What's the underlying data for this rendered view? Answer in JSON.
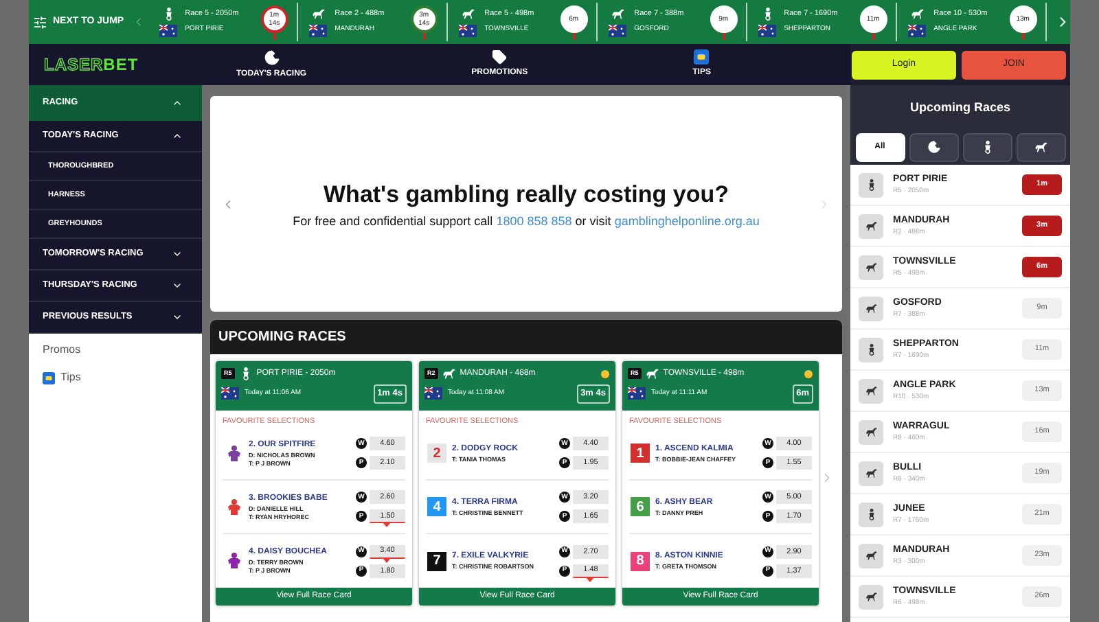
{
  "next_to_jump": {
    "label": "NEXT TO JUMP",
    "races": [
      {
        "kind": "harness",
        "race": "Race 5 - 2050m",
        "venue": "PORT PIRIE",
        "timer": "1m 14s",
        "color": "#c62828"
      },
      {
        "kind": "greyhound",
        "race": "Race 2 - 488m",
        "venue": "MANDURAH",
        "timer": "3m 14s",
        "color": "#2e7d32"
      },
      {
        "kind": "greyhound",
        "race": "Race 5 - 498m",
        "venue": "TOWNSVILLE",
        "timer": "6m",
        "color": "#ffffff"
      },
      {
        "kind": "greyhound",
        "race": "Race 7 - 388m",
        "venue": "GOSFORD",
        "timer": "9m",
        "color": "#ffffff"
      },
      {
        "kind": "harness",
        "race": "Race 7 - 1690m",
        "venue": "SHEPPARTON",
        "timer": "11m",
        "color": "#ffffff"
      },
      {
        "kind": "greyhound",
        "race": "Race 10 - 530m",
        "venue": "ANGLE PARK",
        "timer": "13m",
        "color": "#ffffff"
      }
    ]
  },
  "header": {
    "logo_first": "LASER",
    "logo_second": "BET",
    "nav": [
      {
        "kind": "racing",
        "label": "TODAY'S RACING"
      },
      {
        "kind": "promotions",
        "label": "PROMOTIONS"
      },
      {
        "kind": "tips",
        "label": "TIPS"
      }
    ],
    "login": "Login",
    "join": "JOIN"
  },
  "sidebar": {
    "items": [
      {
        "label": "RACING",
        "selected": true,
        "expanded": true,
        "children": [
          {
            "label": "TODAY'S RACING",
            "selected": false,
            "expanded": true,
            "children": [
              {
                "label": "THOROUGHBRED",
                "selected": false
              },
              {
                "label": "HARNESS",
                "selected": false
              },
              {
                "label": "GREYHOUNDS",
                "selected": false
              }
            ]
          },
          {
            "label": "TOMORROW'S RACING",
            "selected": false,
            "expanded": false
          },
          {
            "label": "THURSDAY'S RACING",
            "selected": false,
            "expanded": false
          },
          {
            "label": "PREVIOUS RESULTS",
            "selected": false,
            "expanded": false
          }
        ]
      }
    ],
    "links": [
      {
        "kind": "text",
        "label": "Promos"
      },
      {
        "kind": "tips",
        "label": "Tips"
      }
    ]
  },
  "banner": {
    "heading": "What's gambling really costing you?",
    "text_before": "For free and confidential support call",
    "phone": "1800 858 858",
    "text_middle": "or visit",
    "website": "gamblinghelponline.org.au"
  },
  "upcoming": {
    "title": "UPCOMING RACES",
    "cards": [
      {
        "race": "R5",
        "kind": "harness",
        "title": "PORT PIRIE - 2050m",
        "sunny": false,
        "time": "Today at 11:06 AM",
        "countdown": "1m 4s",
        "section": "FAVOURITE SELECTIONS",
        "button": "View Full Race Card",
        "runners": [
          {
            "kind": "silk",
            "color": "#7b3fa0",
            "name": "2. OUR SPITFIRE",
            "lines": [
              "D: NICHOLAS BROWN",
              "T: P J BROWN"
            ],
            "prices": [
              {
                "label": "W",
                "odds": "4.60",
                "drifting": false
              },
              {
                "label": "P",
                "odds": "2.10",
                "drifting": false
              }
            ]
          },
          {
            "kind": "silk",
            "color": "#e53935",
            "name": "3. BROOKIES BABE",
            "lines": [
              "D: DANIELLE HILL",
              "T: RYAN HRYHOREC"
            ],
            "prices": [
              {
                "label": "W",
                "odds": "2.60",
                "drifting": false
              },
              {
                "label": "P",
                "odds": "1.50",
                "drifting": true
              }
            ]
          },
          {
            "kind": "silk",
            "color": "#8e24aa",
            "name": "4. DAISY BOUCHEA",
            "lines": [
              "D: TERRY BROWN",
              "T: P J BROWN"
            ],
            "prices": [
              {
                "label": "W",
                "odds": "3.40",
                "drifting": true
              },
              {
                "label": "P",
                "odds": "1.80",
                "drifting": false
              }
            ]
          }
        ]
      },
      {
        "race": "R2",
        "kind": "greyhound",
        "title": "MANDURAH - 488m",
        "sunny": true,
        "time": "Today at 11:08 AM",
        "countdown": "3m 4s",
        "section": "FAVOURITE SELECTIONS",
        "button": "View Full Race Card",
        "runners": [
          {
            "kind": "rug",
            "color": "#e5e5e5",
            "number": "2",
            "name": "2. DODGY ROCK",
            "lines": [
              "T: TANIA THOMAS"
            ],
            "prices": [
              {
                "label": "W",
                "odds": "4.40",
                "drifting": false
              },
              {
                "label": "P",
                "odds": "1.95",
                "drifting": false
              }
            ]
          },
          {
            "kind": "rug",
            "color": "#2196f3",
            "number": "4",
            "name": "4. TERRA FIRMA",
            "lines": [
              "T: CHRISTINE BENNETT"
            ],
            "prices": [
              {
                "label": "W",
                "odds": "3.20",
                "drifting": false
              },
              {
                "label": "P",
                "odds": "1.65",
                "drifting": false
              }
            ]
          },
          {
            "kind": "rug",
            "color": "#111111",
            "number": "7",
            "name": "7. EXILE VALKYRIE",
            "lines": [
              "T: CHRISTINE ROBARTSON"
            ],
            "prices": [
              {
                "label": "W",
                "odds": "2.70",
                "drifting": false
              },
              {
                "label": "P",
                "odds": "1.48",
                "drifting": true
              }
            ]
          }
        ]
      },
      {
        "race": "R5",
        "kind": "greyhound",
        "title": "TOWNSVILLE - 498m",
        "sunny": true,
        "time": "Today at 11:11 AM",
        "countdown": "6m",
        "section": "FAVOURITE SELECTIONS",
        "button": "View Full Race Card",
        "runners": [
          {
            "kind": "rug",
            "color": "#d32f2f",
            "number": "1",
            "name": "1. ASCEND KALMIA",
            "lines": [
              "T: BOBBIE-JEAN CHAFFEY"
            ],
            "prices": [
              {
                "label": "W",
                "odds": "4.00",
                "drifting": false
              },
              {
                "label": "P",
                "odds": "1.55",
                "drifting": false
              }
            ]
          },
          {
            "kind": "rug",
            "color": "#43a047",
            "number": "6",
            "name": "6. ASHY BEAR",
            "lines": [
              "T: DANNY PREH"
            ],
            "prices": [
              {
                "label": "W",
                "odds": "5.00",
                "drifting": false
              },
              {
                "label": "P",
                "odds": "1.70",
                "drifting": false
              }
            ]
          },
          {
            "kind": "rug",
            "color": "#ec407a",
            "number": "8",
            "name": "8. ASTON KINNIE",
            "lines": [
              "T: GRETA THOMSON"
            ],
            "prices": [
              {
                "label": "W",
                "odds": "2.90",
                "drifting": false
              },
              {
                "label": "P",
                "odds": "1.37",
                "drifting": false
              }
            ]
          }
        ]
      }
    ]
  },
  "races_panel": {
    "title": "Upcoming Races",
    "filters": [
      {
        "kind": "all",
        "label": "All",
        "selected": true
      },
      {
        "kind": "thoroughbred",
        "selected": false
      },
      {
        "kind": "harness",
        "selected": false
      },
      {
        "kind": "greyhound",
        "selected": false
      }
    ],
    "races": [
      {
        "kind": "harness",
        "venue": "PORT PIRIE",
        "meta": "R5 · 2050m",
        "time": "1m",
        "urgent": true
      },
      {
        "kind": "greyhound",
        "venue": "MANDURAH",
        "meta": "R2 · 488m",
        "time": "3m",
        "urgent": true
      },
      {
        "kind": "greyhound",
        "venue": "TOWNSVILLE",
        "meta": "R5 · 498m",
        "time": "6m",
        "urgent": true
      },
      {
        "kind": "greyhound",
        "venue": "GOSFORD",
        "meta": "R7 · 388m",
        "time": "9m",
        "urgent": false
      },
      {
        "kind": "harness",
        "venue": "SHEPPARTON",
        "meta": "R7 · 1690m",
        "time": "11m",
        "urgent": false
      },
      {
        "kind": "greyhound",
        "venue": "ANGLE PARK",
        "meta": "R10 · 530m",
        "time": "13m",
        "urgent": false
      },
      {
        "kind": "greyhound",
        "venue": "WARRAGUL",
        "meta": "R8 · 460m",
        "time": "16m",
        "urgent": false
      },
      {
        "kind": "greyhound",
        "venue": "BULLI",
        "meta": "R8 · 340m",
        "time": "19m",
        "urgent": false
      },
      {
        "kind": "harness",
        "venue": "JUNEE",
        "meta": "R7 · 1760m",
        "time": "21m",
        "urgent": false
      },
      {
        "kind": "greyhound",
        "venue": "MANDURAH",
        "meta": "R3 · 300m",
        "time": "23m",
        "urgent": false
      },
      {
        "kind": "greyhound",
        "venue": "TOWNSVILLE",
        "meta": "R6 · 498m",
        "time": "26m",
        "urgent": false
      }
    ]
  }
}
